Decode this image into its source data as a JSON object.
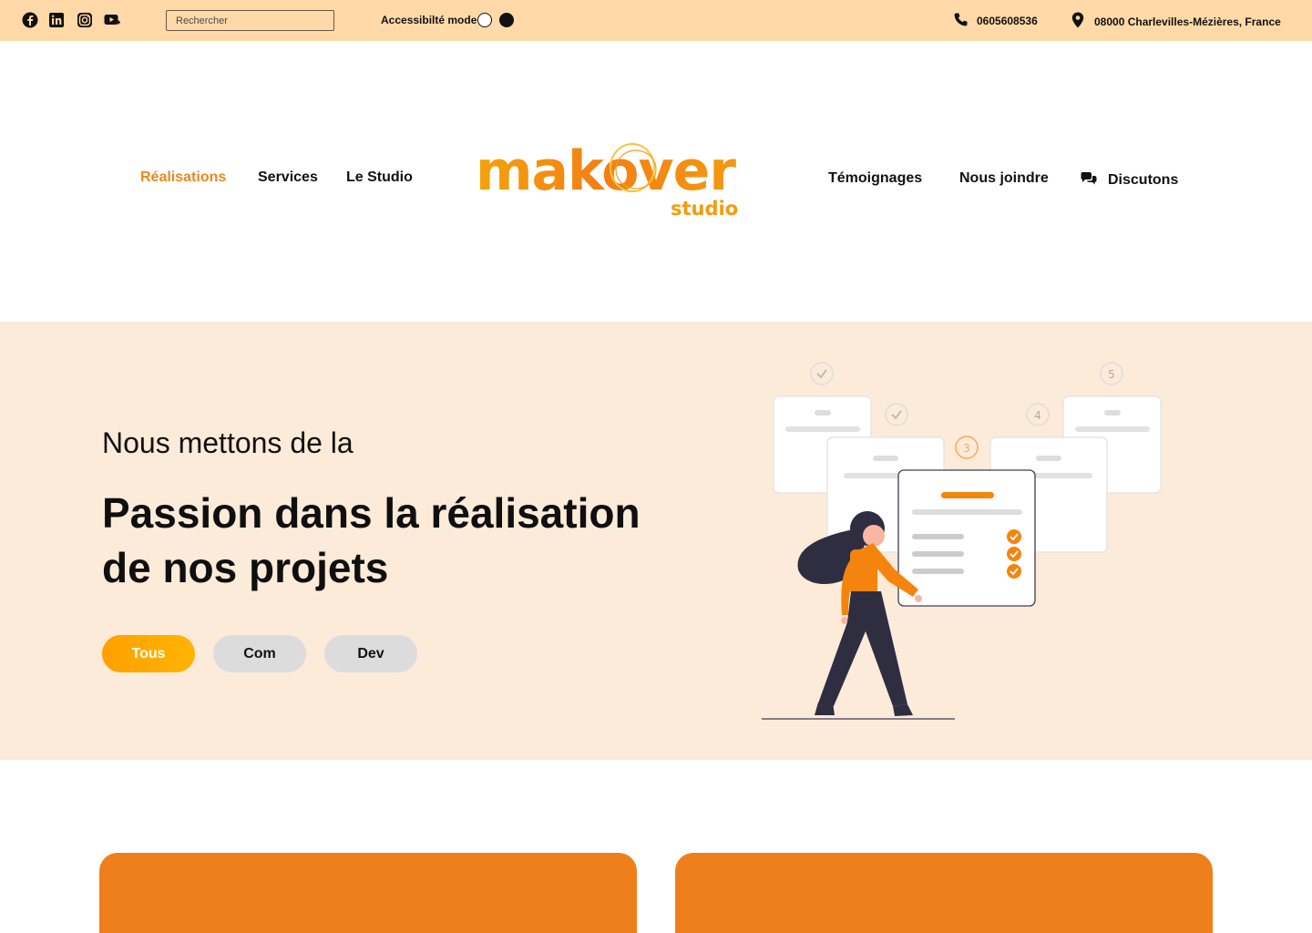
{
  "topbar": {
    "social": [
      {
        "icon": "facebook-icon"
      },
      {
        "icon": "linkedin-icon"
      },
      {
        "icon": "instagram-icon"
      },
      {
        "icon": "youtube-icon"
      }
    ],
    "search_placeholder": "Rechercher",
    "accessibility_label": "Accessibilté mode",
    "phone": "0605608536",
    "address": "08000 Charlevilles-Mézières, France"
  },
  "nav": {
    "left": [
      "Réalisations",
      "Services",
      "Le Studio"
    ],
    "right": [
      "Témoignages",
      "Nous joindre",
      "Discutons"
    ]
  },
  "logo": {
    "main": "makover",
    "sub": "studio"
  },
  "hero": {
    "subtitle": "Nous mettons de la",
    "title": "Passion dans la réalisation de nos projets",
    "filters": [
      "Tous",
      "Com",
      "Dev"
    ],
    "steps": [
      "3",
      "4",
      "5"
    ]
  },
  "colors": {
    "topbar": "#ffd9a8",
    "accent": "#f0871c",
    "hero_bg": "#fdebd9",
    "card": "#ef7f1b"
  }
}
